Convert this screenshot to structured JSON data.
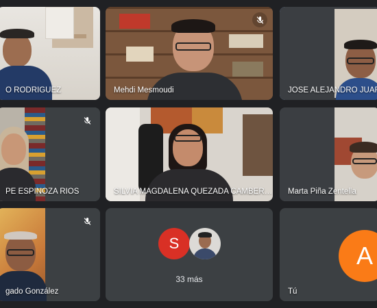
{
  "tiles": [
    {
      "name": "O RODRIGUEZ",
      "muted": false
    },
    {
      "name": "Mehdi Mesmoudi",
      "muted": true
    },
    {
      "name": "JOSE ALEJANDRO JUAREZ",
      "muted": false,
      "active": true
    },
    {
      "name": "PE ESPINOZA RIOS",
      "muted": true
    },
    {
      "name": "SILVIA MAGDALENA QUEZADA CAMBER…",
      "muted": false
    },
    {
      "name": "Marta Piña Zentella",
      "muted": false
    },
    {
      "name": "gado González",
      "muted": true
    },
    {
      "name": "",
      "muted": false
    },
    {
      "name": "Tú",
      "muted": false
    }
  ],
  "more": {
    "avatar_letter": "S",
    "label": "33 más"
  },
  "self": {
    "avatar_letter": "A"
  },
  "colors": {
    "accent": "#8ab4f8",
    "avatar_s": "#d93025",
    "avatar_a": "#fa7b17"
  }
}
